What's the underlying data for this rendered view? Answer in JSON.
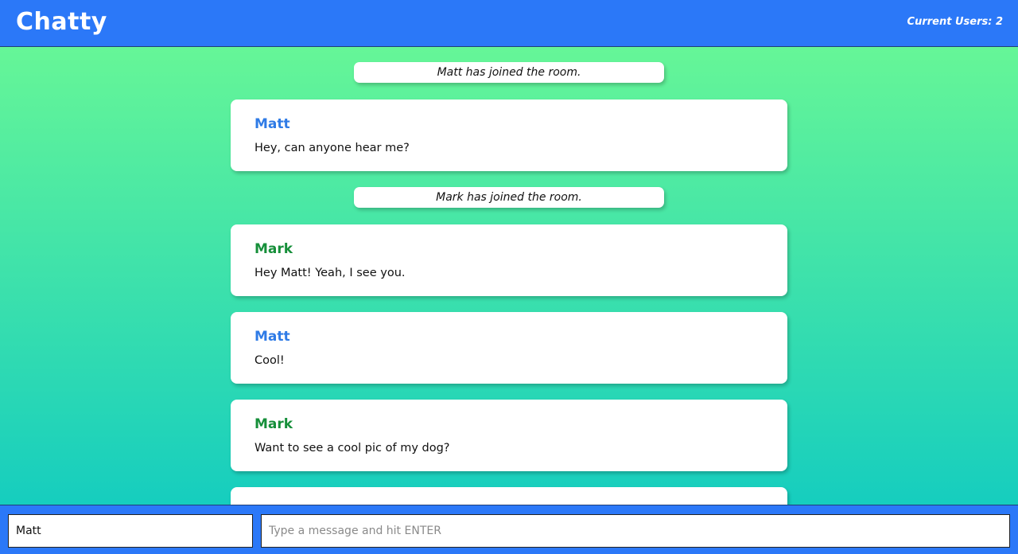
{
  "header": {
    "brand": "Chatty",
    "user_count": "Current Users: 2"
  },
  "colors": {
    "accent": "#2b78f8",
    "gradient_top": "#6efa93",
    "gradient_bottom": "#0dc9c3",
    "matt": "#2f7be6",
    "mark": "#168f3a"
  },
  "notifications": [
    {
      "text": "Matt has joined the room."
    },
    {
      "text": "Mark has joined the room."
    }
  ],
  "messages": [
    {
      "username": "Matt",
      "content": "Hey, can anyone hear me?"
    },
    {
      "username": "Mark",
      "content": "Hey Matt! Yeah, I see you."
    },
    {
      "username": "Matt",
      "content": "Cool!"
    },
    {
      "username": "Mark",
      "content": "Want to see a cool pic of my dog?"
    },
    {
      "username": "",
      "content": ""
    }
  ],
  "chatbar": {
    "username_value": "Matt",
    "message_placeholder": "Type a message and hit ENTER"
  }
}
